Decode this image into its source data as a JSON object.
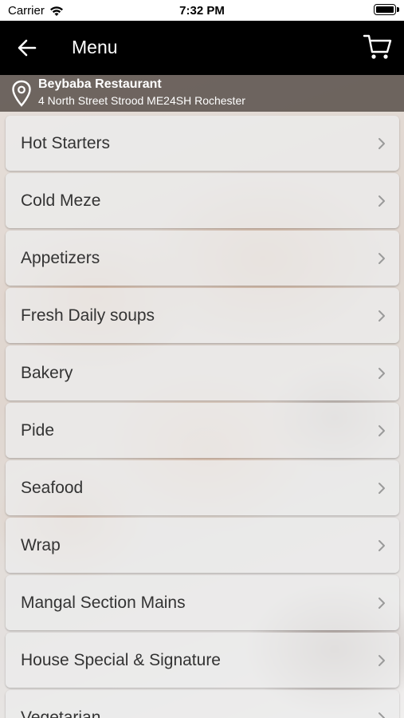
{
  "status_bar": {
    "carrier": "Carrier",
    "time": "7:32 PM"
  },
  "nav": {
    "title": "Menu",
    "back_icon": "arrow-left-icon",
    "cart_icon": "cart-icon"
  },
  "location": {
    "icon": "map-pin-icon",
    "restaurant_name": "Beybaba Restaurant",
    "address": "4 North Street Strood ME24SH Rochester"
  },
  "menu": {
    "items": [
      {
        "label": "Hot Starters"
      },
      {
        "label": "Cold Meze"
      },
      {
        "label": "Appetizers"
      },
      {
        "label": "Fresh Daily soups"
      },
      {
        "label": "Bakery"
      },
      {
        "label": "Pide"
      },
      {
        "label": "Seafood"
      },
      {
        "label": "Wrap"
      },
      {
        "label": "Mangal Section Mains"
      },
      {
        "label": "House Special & Signature"
      },
      {
        "label": "Vegetarian"
      }
    ]
  }
}
